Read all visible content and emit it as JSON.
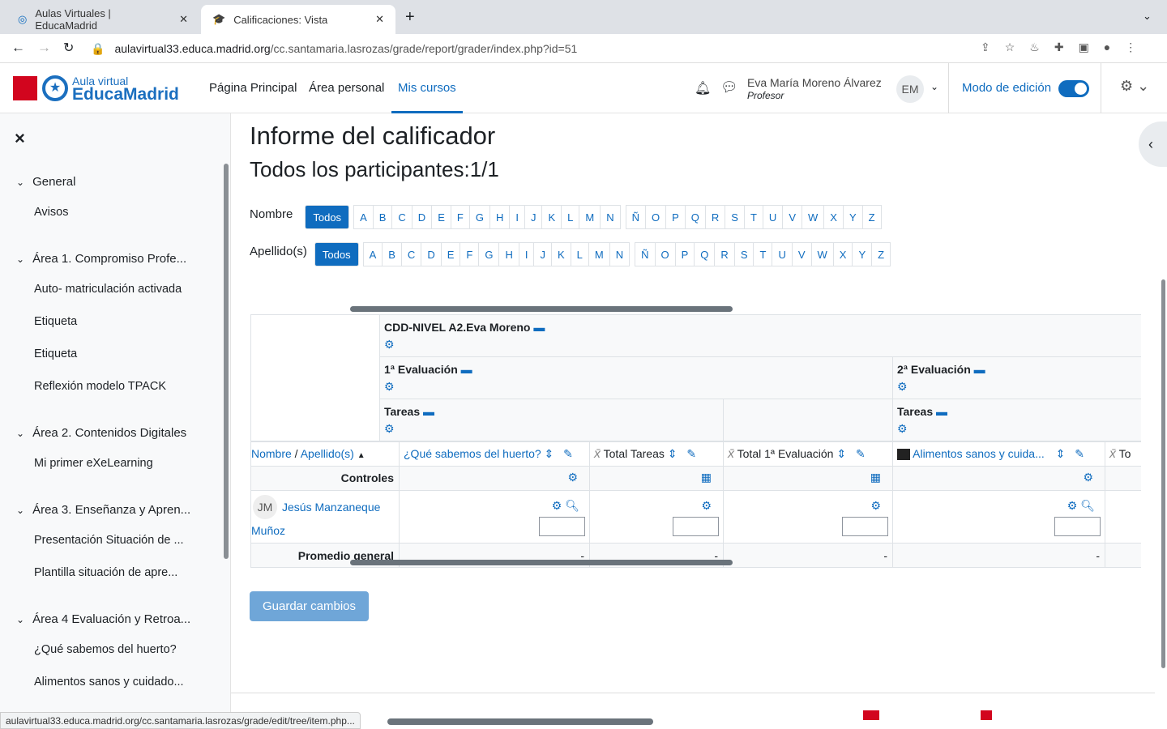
{
  "browser": {
    "tabs": [
      {
        "label": "Aulas Virtuales | EducaMadrid"
      },
      {
        "label": "Calificaciones: Vista"
      }
    ],
    "url_domain": "aulavirtual33.educa.madrid.org",
    "url_path": "/cc.santamaria.lasrozas/grade/report/grader/index.php?id=51",
    "status_url": "aulavirtual33.educa.madrid.org/cc.santamaria.lasrozas/grade/edit/tree/item.php..."
  },
  "header": {
    "logo_top": "Aula virtual",
    "logo_bottom": "EducaMadrid",
    "nav": [
      "Página Principal",
      "Área personal",
      "Mis cursos"
    ],
    "user_name": "Eva María Moreno Álvarez",
    "user_role": "Profesor",
    "initials": "EM",
    "edit_mode": "Modo de edición",
    "edit_on": true
  },
  "sidebar": {
    "close": "×",
    "sections": [
      {
        "title": "General",
        "items": [
          "Avisos"
        ]
      },
      {
        "title": "Área 1. Compromiso Profe...",
        "items": [
          "Auto- matriculación activada",
          "Etiqueta",
          "Etiqueta",
          "Reflexión modelo TPACK"
        ]
      },
      {
        "title": "Área 2. Contenidos Digitales",
        "items": [
          "Mi primer eXeLearning"
        ]
      },
      {
        "title": "Área 3. Enseñanza y Apren...",
        "items": [
          "Presentación Situación de ...",
          "Plantilla situación de apre..."
        ]
      },
      {
        "title": "Área 4 Evaluación y Retroa...",
        "items": [
          "¿Qué sabemos del huerto?",
          "Alimentos sanos y cuidado..."
        ]
      }
    ]
  },
  "page": {
    "title": "Informe del calificador",
    "subtitle": "Todos los participantes:1/1",
    "first_label": "Nombre",
    "last_label": "Apellido(s)",
    "all": "Todos",
    "letters_a": [
      "A",
      "B",
      "C",
      "D",
      "E",
      "F",
      "G",
      "H",
      "I",
      "J",
      "K",
      "L",
      "M",
      "N"
    ],
    "letters_b": [
      "Ñ",
      "O",
      "P",
      "Q",
      "R",
      "S",
      "T",
      "U",
      "V",
      "W",
      "X",
      "Y",
      "Z"
    ]
  },
  "grader": {
    "course": "CDD-NIVEL A2.Eva Moreno",
    "eval1": "1ª Evaluación",
    "eval2": "2ª Evaluación",
    "tareas": "Tareas",
    "name_sort": "Nombre",
    "sep": " / ",
    "surname_sort": "Apellido(s)",
    "columns": [
      "¿Qué sabemos del huerto?",
      "Total Tareas",
      "Total 1ª Evaluación",
      "Alimentos sanos y cuida...",
      "To"
    ],
    "controls": "Controles",
    "student_initials": "JM",
    "student_name": "Jesús Manzaneque",
    "student_name2": "Muñoz",
    "average": "Promedio general",
    "avg_values": [
      "-",
      "-",
      "-",
      "-"
    ]
  },
  "save": "Guardar cambios"
}
